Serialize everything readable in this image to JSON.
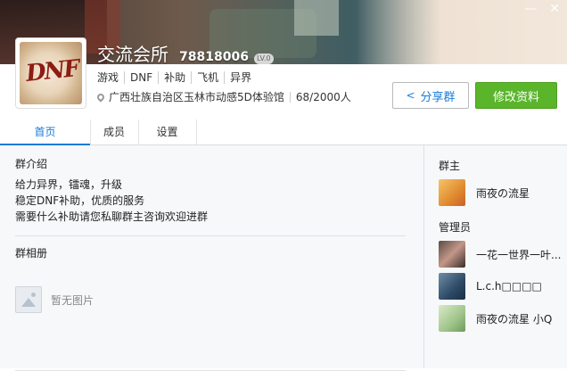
{
  "window": {
    "minimize": "—",
    "close": "✕"
  },
  "group": {
    "name": "交流会所",
    "id": "78818006",
    "level": "LV.0",
    "avatar_text": "DNF",
    "tags": [
      "游戏",
      "DNF",
      "补助",
      "飞机",
      "异界"
    ],
    "location": "广西壮族自治区玉林市动感5D体验馆",
    "members": "68/2000人"
  },
  "buttons": {
    "share": "分享群",
    "edit": "修改资料"
  },
  "tabs": [
    "首页",
    "成员",
    "设置"
  ],
  "intro": {
    "title": "群介绍",
    "lines": [
      "给力异界，镭魂，升级",
      "稳定DNF补助，优质的服务",
      "需要什么补助请您私聊群主咨询欢迎进群"
    ]
  },
  "album": {
    "title": "群相册",
    "empty": "暂无图片"
  },
  "owner": {
    "title": "群主",
    "name": "雨夜の流星"
  },
  "admins": {
    "title": "管理员",
    "list": [
      "一花一世界一叶...",
      "L.c.h□□□□",
      "雨夜の流星 小Q"
    ]
  }
}
